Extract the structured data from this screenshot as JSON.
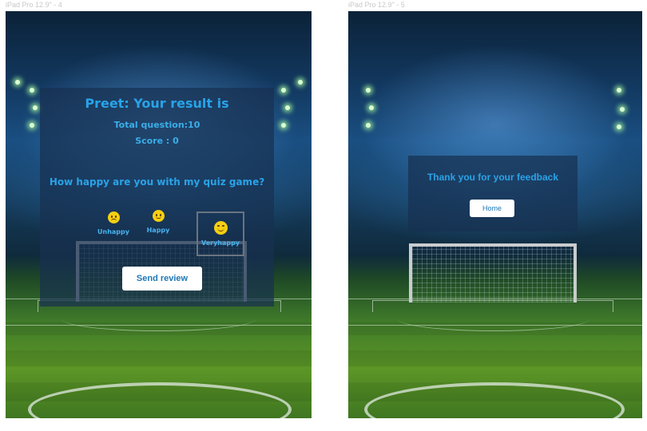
{
  "frames": [
    {
      "label": "iPad Pro 12.9\" - 4"
    },
    {
      "label": "iPad Pro 12.9\" - 5"
    }
  ],
  "result": {
    "title": "Preet: Your result is",
    "total_questions": "Total question:10",
    "score": "Score : 0",
    "question": "How happy are you with my quiz game?",
    "options": [
      {
        "label": "Unhappy",
        "icon": "unhappy-face-icon"
      },
      {
        "label": "Happy",
        "icon": "happy-face-icon"
      },
      {
        "label": "Veryhappy",
        "icon": "very-happy-face-icon",
        "selected": true
      }
    ],
    "send_label": "Send review"
  },
  "thanks": {
    "message": "Thank you for your feedback",
    "home_label": "Home"
  },
  "colors": {
    "accent_text": "#29a3e8",
    "button_text": "#1f78b6",
    "emoji": "#f5cf12",
    "overlay": "#183050"
  }
}
